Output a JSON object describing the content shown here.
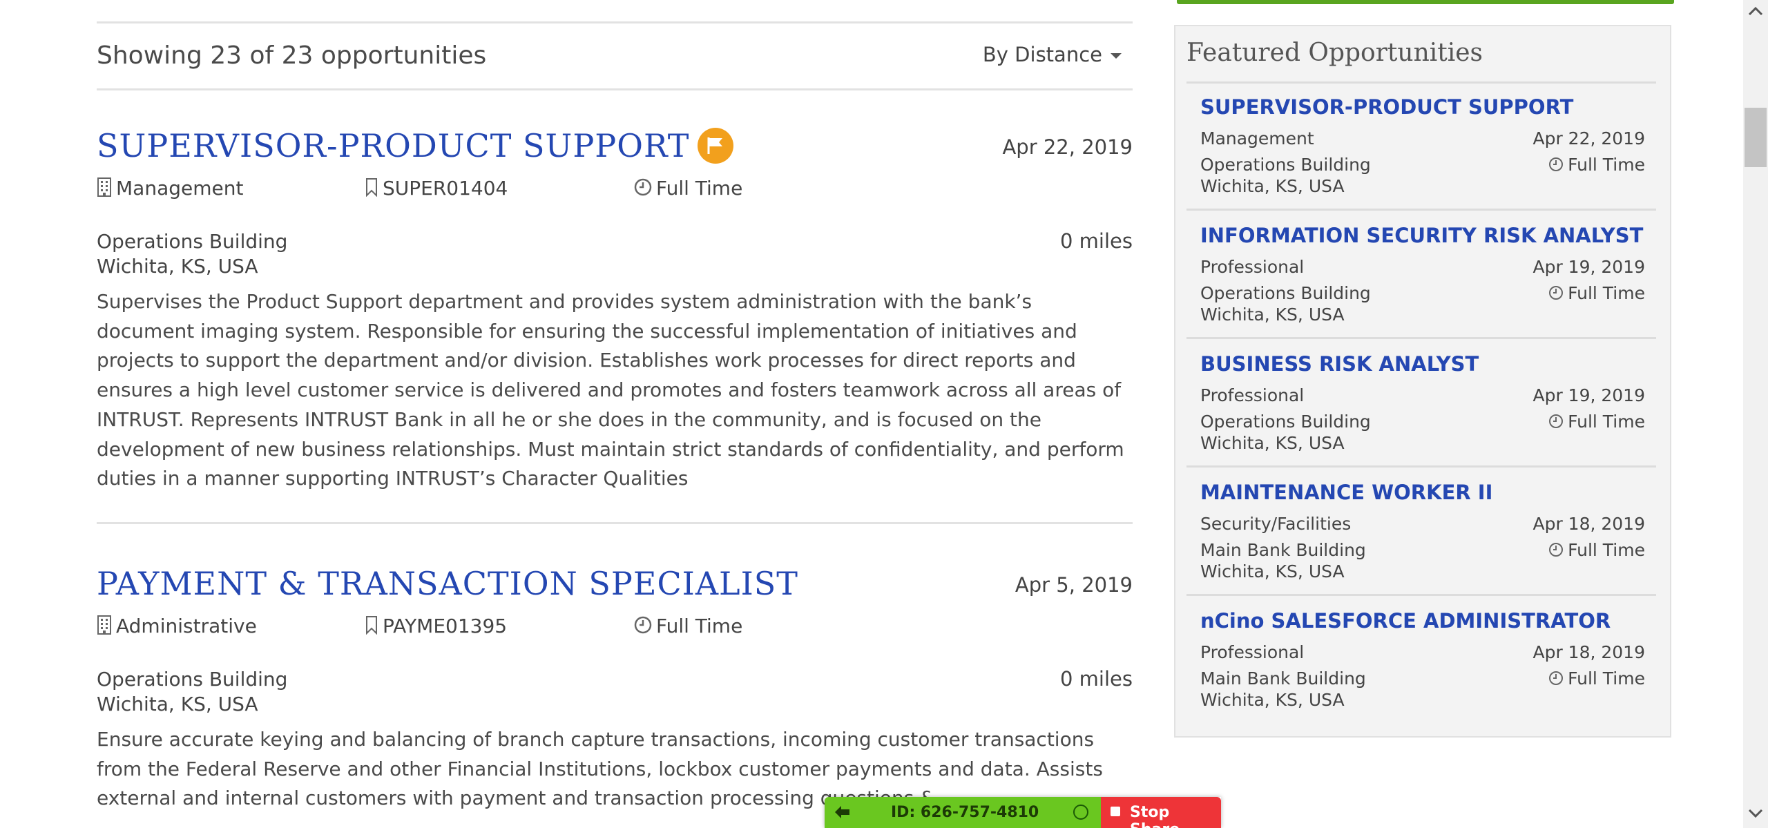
{
  "results": {
    "count_text": "Showing 23 of 23 opportunities",
    "sort_label": "By Distance"
  },
  "jobs": [
    {
      "title": "SUPERVISOR-PRODUCT SUPPORT",
      "date": "Apr 22, 2019",
      "category": "Management",
      "req_id": "SUPER01404",
      "type": "Full Time",
      "building": "Operations Building",
      "city": "Wichita, KS, USA",
      "distance": "0 miles",
      "description": "Supervises the Product Support department and provides system administration with the bank’s document imaging system. Responsible for ensuring the successful implementation of initiatives and projects to support the department and/or division. Establishes work processes for direct reports and ensures a high level customer service is delivered and promotes and fosters teamwork across all areas of INTRUST. Represents INTRUST Bank in all he or she does in the community, and is focused on the development of new business relationships. Must maintain strict standards of confidentiality, and perform duties in a manner supporting INTRUST’s Character Qualities",
      "featured": true
    },
    {
      "title": "PAYMENT & TRANSACTION SPECIALIST",
      "date": "Apr 5, 2019",
      "category": "Administrative",
      "req_id": "PAYME01395",
      "type": "Full Time",
      "building": "Operations Building",
      "city": "Wichita, KS, USA",
      "distance": "0 miles",
      "description": "Ensure accurate keying and balancing of branch capture transactions, incoming customer transactions from the Federal Reserve and other Financial Institutions, lockbox customer payments and data. Assists external and internal customers with payment and transaction processing questions &",
      "featured": false
    }
  ],
  "sidebar": {
    "title": "Featured Opportunities",
    "items": [
      {
        "title": "SUPERVISOR-PRODUCT SUPPORT",
        "category": "Management",
        "date": "Apr 22, 2019",
        "building": "Operations Building",
        "type": "Full Time",
        "city": "Wichita, KS, USA"
      },
      {
        "title": "INFORMATION SECURITY RISK ANALYST",
        "category": "Professional",
        "date": "Apr 19, 2019",
        "building": "Operations Building",
        "type": "Full Time",
        "city": "Wichita, KS, USA"
      },
      {
        "title": "BUSINESS RISK ANALYST",
        "category": "Professional",
        "date": "Apr 19, 2019",
        "building": "Operations Building",
        "type": "Full Time",
        "city": "Wichita, KS, USA"
      },
      {
        "title": "MAINTENANCE WORKER II",
        "category": "Security/Facilities",
        "date": "Apr 18, 2019",
        "building": "Main Bank Building",
        "type": "Full Time",
        "city": "Wichita, KS, USA"
      },
      {
        "title": "nCino SALESFORCE ADMINISTRATOR",
        "category": "Professional",
        "date": "Apr 18, 2019",
        "building": "Main Bank Building",
        "type": "Full Time",
        "city": "Wichita, KS, USA"
      }
    ]
  },
  "share_bar": {
    "id_text": "ID: 626-757-4810",
    "stop_label": "Stop Share"
  },
  "icons": {
    "category": "building-icon",
    "req_id": "bookmark-icon",
    "type": "clock-icon",
    "featured": "flag-icon"
  },
  "colors": {
    "title_blue": "#2447b2",
    "flag_orange": "#f2a01d",
    "share_green": "#6ac720",
    "stop_red": "#ee3438",
    "accent_green": "#59a51f"
  }
}
